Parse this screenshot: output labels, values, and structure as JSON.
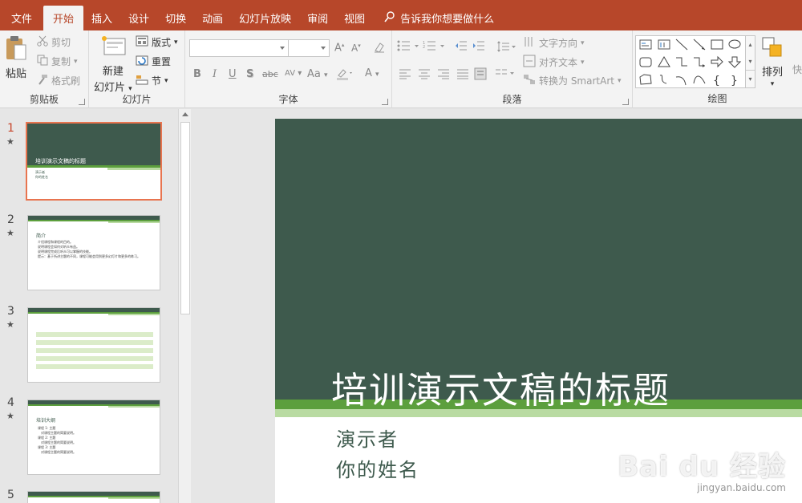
{
  "tabs": [
    "文件",
    "开始",
    "插入",
    "设计",
    "切换",
    "动画",
    "幻灯片放映",
    "审阅",
    "视图"
  ],
  "active_tab": "开始",
  "tell_me": "告诉我你想要做什么",
  "clipboard": {
    "label": "剪贴板",
    "paste": "粘贴",
    "cut": "剪切",
    "copy": "复制",
    "painter": "格式刷"
  },
  "slides_group": {
    "label": "幻灯片",
    "new_line1": "新建",
    "new_line2": "幻灯片",
    "layout": "版式",
    "reset": "重置",
    "section": "节"
  },
  "font_group": {
    "label": "字体",
    "font_name": "",
    "font_size": "",
    "bold": "B",
    "italic": "I",
    "underline": "U",
    "shadow": "S",
    "strike": "abc",
    "spacing": "AV",
    "case": "Aa"
  },
  "paragraph_group": {
    "label": "段落",
    "text_direction": "文字方向",
    "align_text": "对齐文本",
    "smartart": "转换为 SmartArt"
  },
  "drawing_group": {
    "label": "绘图",
    "arrange": "排列",
    "quick": "快"
  },
  "slides": [
    {
      "num": "1",
      "star": "★",
      "title": "培训演示文稿的标题",
      "lines": [
        "演示者",
        "你的姓名"
      ]
    },
    {
      "num": "2",
      "star": "★",
      "title": "简介",
      "bullets": [
        "介绍课程和课程的目的。",
        "说明课程会如何对听众有益。",
        "说明课程完成后听众可以掌握的技能。",
        "提示：基于所讲主题的不同，课程可能会用到更多幻灯片和更多的练习。"
      ]
    },
    {
      "num": "3",
      "star": "★"
    },
    {
      "num": "4",
      "star": "★",
      "title": "培训大纲",
      "bullets": [
        "课程 1: 主题",
        "　对课程主题的简要说明。",
        "课程 2: 主题",
        "　对课程主题的简要说明。",
        "课程 3: 主题",
        "　对课程主题的简要说明。"
      ]
    },
    {
      "num": "5"
    }
  ],
  "main_slide": {
    "title": "培训演示文稿的标题",
    "presenter": "演示者",
    "name": "你的姓名"
  },
  "watermark": {
    "logo": "Bai du 经验",
    "url": "jingyan.baidu.com"
  },
  "colors": {
    "accent": "#b7472a",
    "slide_dark": "#3e5a4d",
    "slide_green": "#5c9f3d",
    "slide_light": "#b9dba2"
  }
}
